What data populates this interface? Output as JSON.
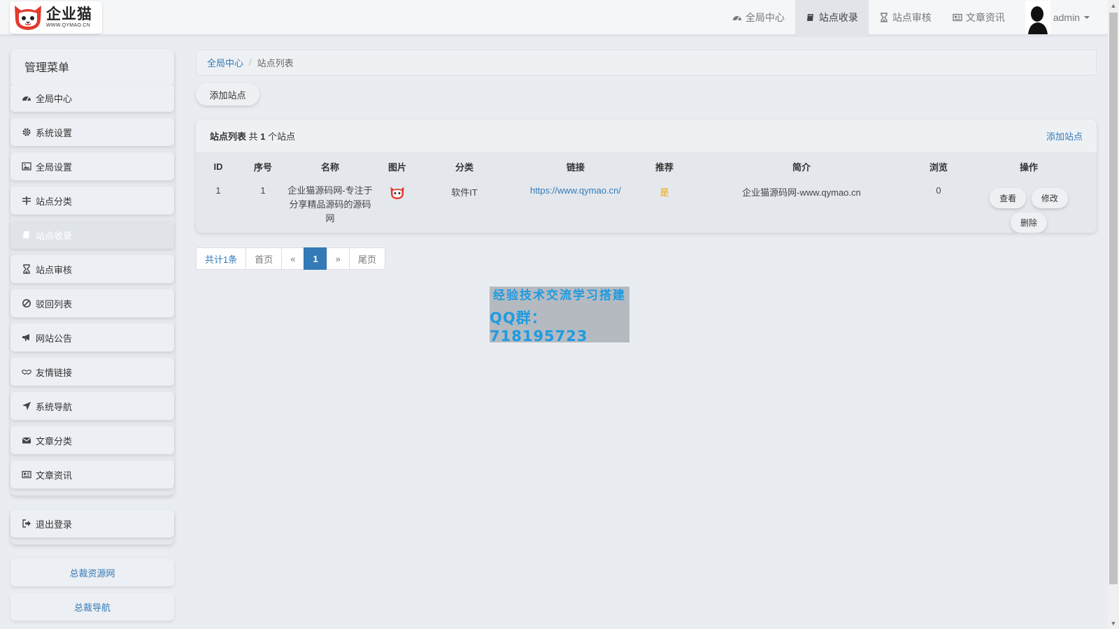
{
  "brand": {
    "name": "企业猫",
    "url": "WWW.QYMAO.CN"
  },
  "topnav": {
    "items": [
      {
        "label": "全局中心",
        "icon": "dashboard-icon"
      },
      {
        "label": "站点收录",
        "icon": "book-icon"
      },
      {
        "label": "站点审核",
        "icon": "hourglass-icon"
      },
      {
        "label": "文章资讯",
        "icon": "newspaper-icon"
      }
    ],
    "active_index": 1,
    "user": "admin"
  },
  "sidebar": {
    "title": "管理菜单",
    "items": [
      {
        "label": "全局中心",
        "icon": "dashboard-icon"
      },
      {
        "label": "系统设置",
        "icon": "gear-icon"
      },
      {
        "label": "全局设置",
        "icon": "image-icon"
      },
      {
        "label": "站点分类",
        "icon": "sliders-icon"
      },
      {
        "label": "站点收录",
        "icon": "book-icon"
      },
      {
        "label": "站点审核",
        "icon": "hourglass-icon"
      },
      {
        "label": "驳回列表",
        "icon": "ban-icon"
      },
      {
        "label": "网站公告",
        "icon": "bullhorn-icon"
      },
      {
        "label": "友情链接",
        "icon": "handshake-icon"
      },
      {
        "label": "系统导航",
        "icon": "location-arrow-icon"
      },
      {
        "label": "文章分类",
        "icon": "envelope-icon"
      },
      {
        "label": "文章资讯",
        "icon": "newspaper-icon"
      }
    ],
    "active_index": 4,
    "logout": {
      "label": "退出登录",
      "icon": "sign-out-icon"
    },
    "links": [
      "总裁资源网",
      "总裁导航"
    ]
  },
  "breadcrumb": {
    "home": "全局中心",
    "current": "站点列表"
  },
  "add_button": "添加站点",
  "panel": {
    "title_bold": "站点列表",
    "title_prefix": "共",
    "count": "1",
    "title_suffix": "个站点",
    "link": "添加站点"
  },
  "table": {
    "headers": [
      "ID",
      "序号",
      "名称",
      "图片",
      "分类",
      "链接",
      "推荐",
      "简介",
      "浏览",
      "操作"
    ],
    "rows": [
      {
        "id": "1",
        "order": "1",
        "name": "企业猫源码网-专注于分享精品源码的源码网",
        "category": "软件IT",
        "url": "https://www.qymao.cn/",
        "recommend": "是",
        "intro": "企业猫源码网-www.qymao.cn",
        "views": "0",
        "actions": [
          "查看",
          "修改",
          "删除"
        ]
      }
    ]
  },
  "pagination": {
    "total": "共计1条",
    "first": "首页",
    "prev": "«",
    "current": "1",
    "next": "»",
    "last": "尾页"
  },
  "promo": {
    "line1": "经验技术交流学习搭建",
    "line2": "QQ群：718195723"
  },
  "colors": {
    "link": "#337ab7",
    "recommend": "#f0a30a",
    "promo_text": "#1e9be0",
    "background": "#e9edf2"
  }
}
